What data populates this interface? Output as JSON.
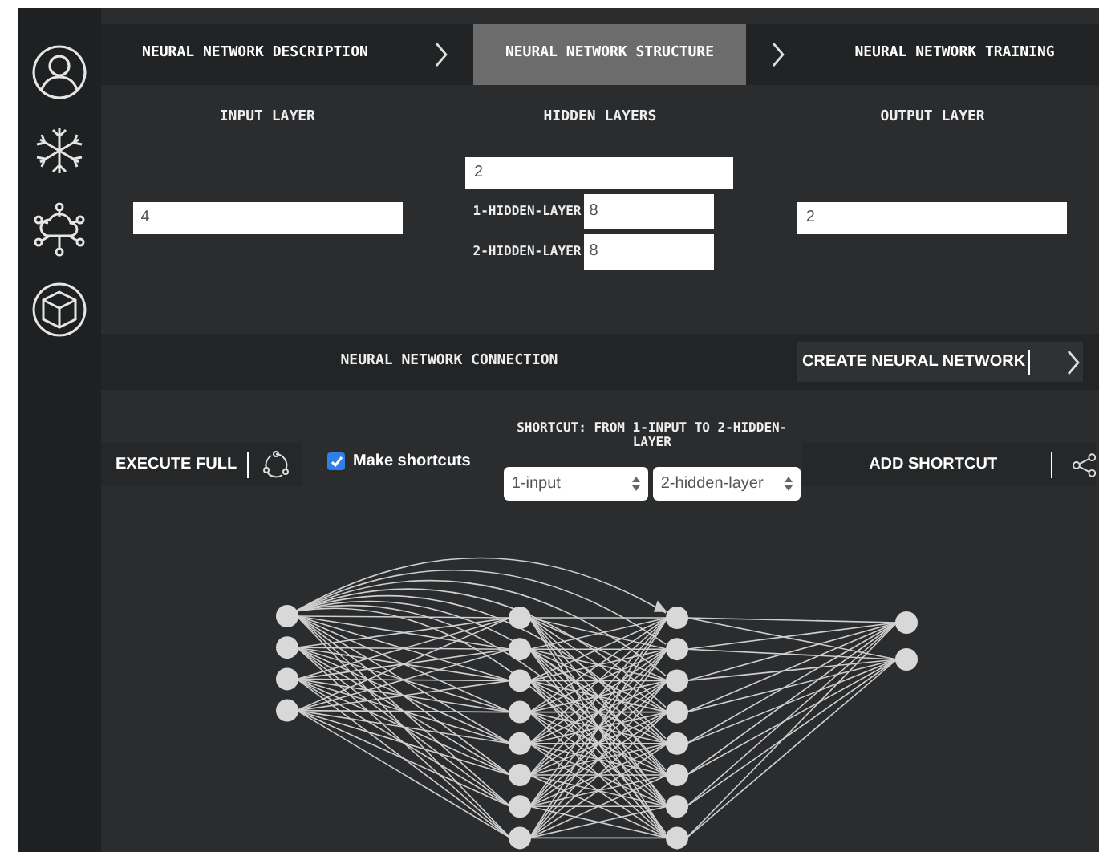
{
  "tabs": [
    {
      "label": "NEURAL NETWORK DESCRIPTION",
      "selected": false
    },
    {
      "label": "NEURAL NETWORK STRUCTURE",
      "selected": true
    },
    {
      "label": "NEURAL NETWORK TRAINING",
      "selected": false
    }
  ],
  "input_layer": {
    "title": "INPUT LAYER",
    "value": "4"
  },
  "hidden_layers": {
    "title": "HIDDEN LAYERS",
    "count": "2",
    "layers": [
      {
        "label": "1-HIDDEN-LAYER",
        "value": "8"
      },
      {
        "label": "2-HIDDEN-LAYER",
        "value": "8"
      }
    ]
  },
  "output_layer": {
    "title": "OUTPUT LAYER",
    "value": "2"
  },
  "connection": {
    "title": "NEURAL NETWORK CONNECTION",
    "create_button": "CREATE NEURAL NETWORK"
  },
  "execute_button": "EXECUTE FULL",
  "make_shortcuts": {
    "label": "Make shortcuts",
    "checked": true
  },
  "shortcut": {
    "title": "SHORTCUT: FROM 1-INPUT TO 2-HIDDEN-LAYER",
    "from": "1-input",
    "to": "2-hidden-layer"
  },
  "add_shortcut_button": "ADD SHORTCUT"
}
